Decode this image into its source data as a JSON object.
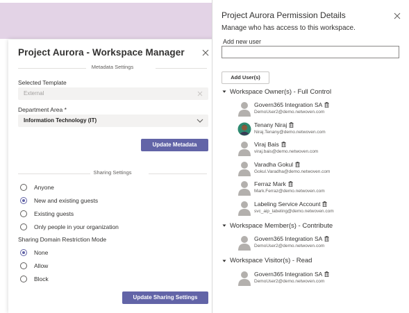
{
  "manager": {
    "title": "Project Aurora - Workspace Manager",
    "metadata_section": "Metadata Settings",
    "template_label": "Selected Template",
    "template_value": "External",
    "department_label": "Department Area *",
    "department_value": "Information Technology (IT)",
    "update_metadata": "Update Metadata",
    "sharing_section": "Sharing Settings",
    "sharing_options": [
      {
        "label": "Anyone",
        "checked": false
      },
      {
        "label": "New and existing guests",
        "checked": true
      },
      {
        "label": "Existing guests",
        "checked": false
      },
      {
        "label": "Only people in your organization",
        "checked": false
      }
    ],
    "domain_mode_label": "Sharing Domain Restriction Mode",
    "domain_options": [
      {
        "label": "None",
        "checked": true
      },
      {
        "label": "Allow",
        "checked": false
      },
      {
        "label": "Block",
        "checked": false
      }
    ],
    "update_sharing": "Update Sharing Settings"
  },
  "permissions": {
    "title": "Project Aurora Permission Details",
    "subtitle": "Manage who has access to this workspace.",
    "add_label": "Add new user",
    "add_placeholder": "",
    "add_button": "Add User(s)",
    "groups": [
      {
        "label": "Workspace Owner(s) - Full Control",
        "users": [
          {
            "name": "Govern365 Integration SA",
            "email": "DemoUser2@demo.netwoven.com",
            "photo": false
          },
          {
            "name": "Tenany Niraj",
            "email": "Niraj.Tenany@demo.netwoven.com",
            "photo": true
          },
          {
            "name": "Viraj Bais",
            "email": "viraj.bais@demo.netwoven.com",
            "photo": false
          },
          {
            "name": "Varadha Gokul",
            "email": "Gokul.Varadha@demo.netwoven.com",
            "photo": false
          },
          {
            "name": "Ferraz Mark",
            "email": "Mark.Ferraz@demo.netwoven.com",
            "photo": false
          },
          {
            "name": "Labeling Service Account",
            "email": "svc_aip_labeling@demo.netwoven.com",
            "photo": false
          }
        ]
      },
      {
        "label": "Workspace Member(s) - Contribute",
        "users": [
          {
            "name": "Govern365 Integration SA",
            "email": "DemoUser2@demo.netwoven.com",
            "photo": false
          }
        ]
      },
      {
        "label": "Workspace Visitor(s) - Read",
        "users": [
          {
            "name": "Govern365 Integration SA",
            "email": "DemoUser2@demo.netwoven.com",
            "photo": false
          }
        ]
      }
    ]
  },
  "icons": {
    "close": "close-icon",
    "clear": "clear-icon",
    "dropdown": "chevron-down-icon",
    "group_toggle": "caret-down-icon",
    "delete": "trash-icon",
    "avatar": "person-avatar-icon"
  },
  "colors": {
    "accent": "#6264a7",
    "backdrop": "#e3d3e6",
    "field_bg": "#f3f2f1"
  }
}
